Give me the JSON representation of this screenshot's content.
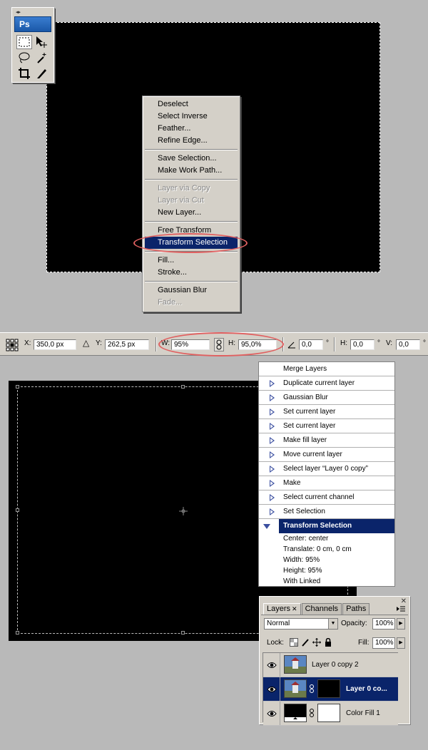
{
  "toolbox": {
    "logo": "Ps",
    "grip": "◂▸"
  },
  "context_menu": {
    "items": [
      {
        "label": "Deselect",
        "state": "normal"
      },
      {
        "label": "Select Inverse",
        "state": "normal"
      },
      {
        "label": "Feather...",
        "state": "normal"
      },
      {
        "label": "Refine Edge...",
        "state": "normal"
      },
      {
        "sep": true
      },
      {
        "label": "Save Selection...",
        "state": "normal"
      },
      {
        "label": "Make Work Path...",
        "state": "normal"
      },
      {
        "sep": true
      },
      {
        "label": "Layer via Copy",
        "state": "disabled"
      },
      {
        "label": "Layer via Cut",
        "state": "disabled"
      },
      {
        "label": "New Layer...",
        "state": "normal"
      },
      {
        "sep": true
      },
      {
        "label": "Free Transform",
        "state": "normal"
      },
      {
        "label": "Transform Selection",
        "state": "selected"
      },
      {
        "sep": true
      },
      {
        "label": "Fill...",
        "state": "normal"
      },
      {
        "label": "Stroke...",
        "state": "normal"
      },
      {
        "sep": true
      },
      {
        "label": "Gaussian Blur",
        "state": "normal"
      },
      {
        "label": "Fade...",
        "state": "disabled"
      }
    ]
  },
  "options_bar": {
    "x_label": "X:",
    "x_value": "350,0 px",
    "delta_symbol": "△",
    "y_label": "Y:",
    "y_value": "262,5 px",
    "w_label": "W:",
    "w_value": "95%",
    "h_label": "H:",
    "h_value": "95,0%",
    "angle_value": "0,0",
    "degree": "°",
    "hskew_label": "H:",
    "hskew_value": "0,0",
    "vskew_label": "V:",
    "vskew_value": "0,0"
  },
  "actions_panel": {
    "rows": [
      {
        "label": "Merge Layers",
        "arrow": false
      },
      {
        "label": "Duplicate current layer",
        "arrow": true
      },
      {
        "label": "Gaussian Blur",
        "arrow": true
      },
      {
        "label": "Set current layer",
        "arrow": true
      },
      {
        "label": "Set current layer",
        "arrow": true
      },
      {
        "label": "Make fill layer",
        "arrow": true
      },
      {
        "label": "Move current layer",
        "arrow": true
      },
      {
        "label": "Select layer “Layer 0 copy”",
        "arrow": true
      },
      {
        "label": "Make",
        "arrow": true
      },
      {
        "label": "Select current channel",
        "arrow": true
      },
      {
        "label": "Set Selection",
        "arrow": true
      }
    ],
    "selected": "Transform Selection",
    "details": [
      "Center: center",
      "Translate: 0 cm, 0 cm",
      "Width: 95%",
      "Height: 95%",
      "With Linked"
    ]
  },
  "layers_panel": {
    "close": "✕",
    "tabs": [
      {
        "label": "Layers",
        "active": true,
        "closable": true
      },
      {
        "label": "Channels",
        "active": false,
        "closable": false
      },
      {
        "label": "Paths",
        "active": false,
        "closable": false
      }
    ],
    "blend_mode": "Normal",
    "opacity_label": "Opacity:",
    "opacity_value": "100%",
    "lock_label": "Lock:",
    "fill_label": "Fill:",
    "fill_value": "100%",
    "layers": [
      {
        "name": "Layer 0 copy 2",
        "selected": false
      },
      {
        "name": "Layer 0 co...",
        "selected": true
      },
      {
        "name": "Color Fill 1",
        "selected": false
      }
    ]
  },
  "colors": {
    "selection_blue": "#0a246a",
    "highlight_red": "#e06060",
    "panel_gray": "#d4d0c8"
  }
}
